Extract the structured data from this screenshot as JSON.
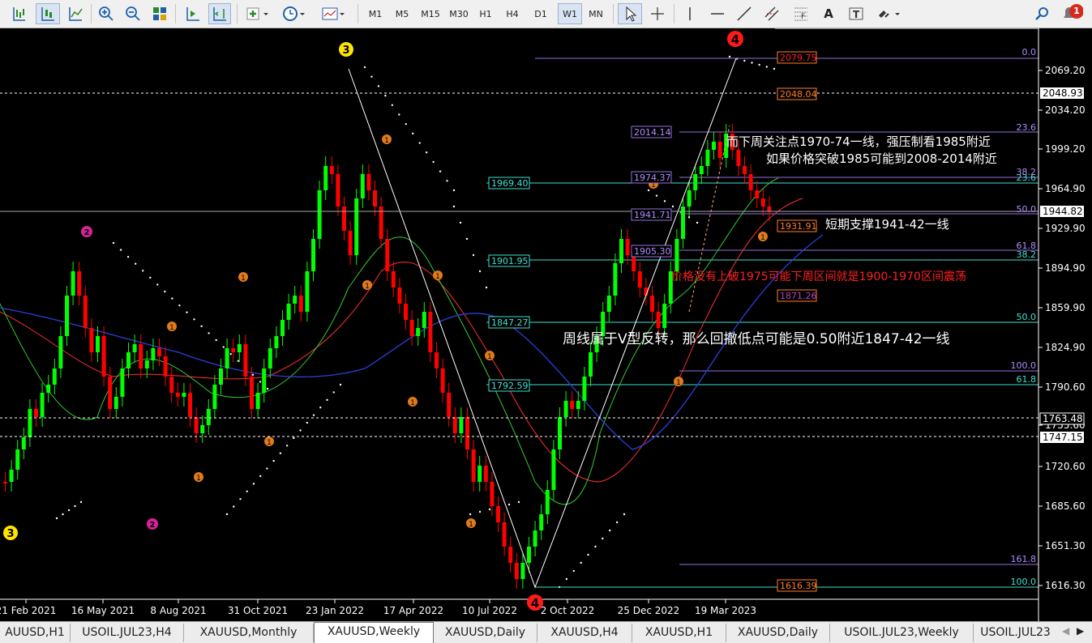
{
  "toolbar": {
    "timeframes": [
      "M1",
      "M5",
      "M15",
      "M30",
      "H1",
      "H4",
      "D1",
      "W1",
      "MN"
    ],
    "active_timeframe": "W1",
    "alert_count": "1"
  },
  "chart": {
    "price_axis": [
      "2069.20",
      "2034.20",
      "1999.20",
      "1964.90",
      "1929.90",
      "1894.90",
      "1859.90",
      "1824.90",
      "1790.60",
      "1755.60",
      "1720.60",
      "1685.60",
      "1651.30",
      "1616.30"
    ],
    "time_axis": [
      "21 Feb 2021",
      "16 May 2021",
      "8 Aug 2021",
      "31 Oct 2021",
      "23 Jan 2022",
      "17 Apr 2022",
      "10 Jul 2022",
      "2 Oct 2022",
      "25 Dec 2022",
      "19 Mar 2023"
    ],
    "price_tags": {
      "high_line": "2048.93",
      "current": "1944.82",
      "upper_level": "1763.48",
      "lower_level": "1747.15"
    },
    "box_labels": {
      "fib_top": "2079.75",
      "fib_2048": "2048.04",
      "level_2014": "2014.14",
      "level_1974": "1974.37",
      "level_1969": "1969.40",
      "level_1941": "1941.71",
      "level_1931": "1931.91",
      "level_1905": "1905.30",
      "level_1901": "1901.95",
      "level_1871": "1871.26",
      "level_1847": "1847.27",
      "level_1792": "1792.59",
      "fib_bottom": "1616.39"
    },
    "fib_percent_labels": {
      "p0": "0.0",
      "p236_a": "23.6",
      "p382_a": "38.2",
      "p236_b": "23.6",
      "p50_a": "50.0",
      "p618_a": "61.8",
      "p382_b": "38.2",
      "p50_b": "50.0",
      "p100_a": "100.0",
      "p618_b": "61.8",
      "p1618": "161.8",
      "p100_b": "100.0"
    },
    "wave_labels": {
      "w3_top": "3",
      "w4_top": "4",
      "w3_left": "3",
      "w4_bottom": "4",
      "w2_upper": "2",
      "w2_lower": "2"
    },
    "small_marker": "1",
    "annotations": {
      "a1": "而下周关注点1970-74一线，强压制看1985附近",
      "a2": "如果价格突破1985可能到2008-2014附近",
      "a3": "短期支撑1941-42一线",
      "a4": "价格没有上破1975可能下周区间就是1900-1970区间震荡",
      "a5": "周线属于V型反转，那么回撤低点可能是0.50附近1847-42一线"
    },
    "colors": {
      "bull": "#00ff00",
      "bear": "#ff0000",
      "fib": "#9370db",
      "cyan": "#40e0d0",
      "ma_red": "#ff3030",
      "ma_green": "#32cd32",
      "ma_blue": "#2b3fd6"
    }
  },
  "tabs": [
    "AUUSD,H1",
    "USOIL.JUL23,H4",
    "XAUUSD,Monthly",
    "XAUUSD,Weekly",
    "XAUUSD,Daily",
    "XAUUSD,H4",
    "XAUUSD,H1",
    "XAUUSD,Daily",
    "USOIL.JUL23,Weekly",
    "USOIL.JUL23"
  ],
  "active_tab": "XAUUSD,Weekly"
}
